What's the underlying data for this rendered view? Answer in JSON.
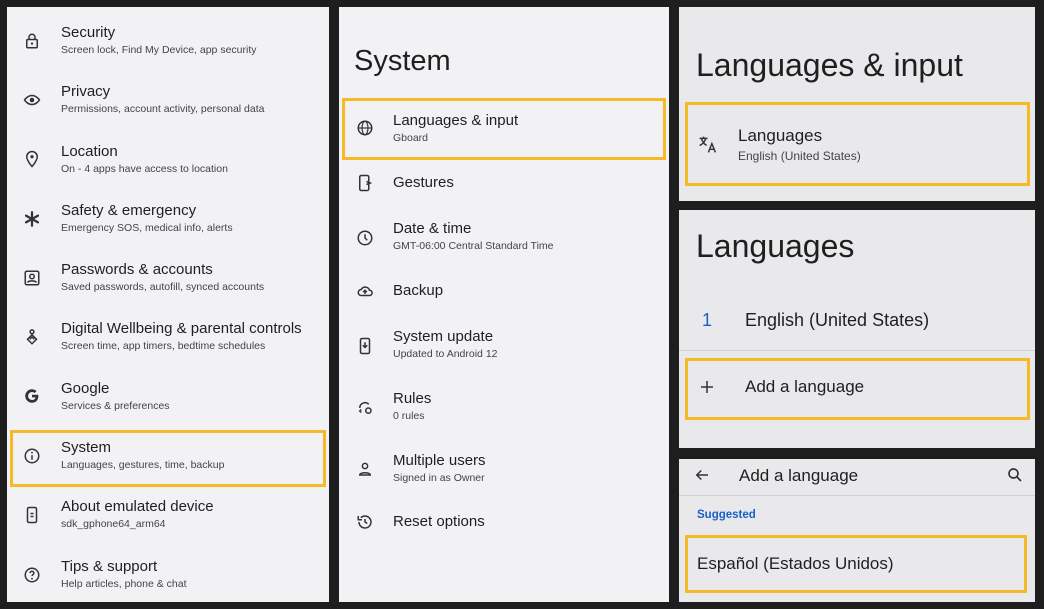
{
  "settings_list": {
    "items": [
      {
        "title": "Security",
        "subtitle": "Screen lock, Find My Device, app security",
        "icon": "lock-icon"
      },
      {
        "title": "Privacy",
        "subtitle": "Permissions, account activity, personal data",
        "icon": "eye-icon"
      },
      {
        "title": "Location",
        "subtitle": "On - 4 apps have access to location",
        "icon": "location-pin-icon"
      },
      {
        "title": "Safety & emergency",
        "subtitle": "Emergency SOS, medical info, alerts",
        "icon": "asterisk-icon"
      },
      {
        "title": "Passwords & accounts",
        "subtitle": "Saved passwords, autofill, synced accounts",
        "icon": "account-box-icon"
      },
      {
        "title": "Digital Wellbeing & parental controls",
        "subtitle": "Screen time, app timers, bedtime schedules",
        "icon": "wellbeing-icon"
      },
      {
        "title": "Google",
        "subtitle": "Services & preferences",
        "icon": "google-g-icon"
      },
      {
        "title": "System",
        "subtitle": "Languages, gestures, time, backup",
        "icon": "info-icon"
      },
      {
        "title": "About emulated device",
        "subtitle": "sdk_gphone64_arm64",
        "icon": "device-icon"
      },
      {
        "title": "Tips & support",
        "subtitle": "Help articles, phone & chat",
        "icon": "help-icon"
      }
    ]
  },
  "system_screen": {
    "title": "System",
    "items": [
      {
        "title": "Languages & input",
        "subtitle": "Gboard",
        "icon": "globe-icon"
      },
      {
        "title": "Gestures",
        "subtitle": "",
        "icon": "gestures-icon"
      },
      {
        "title": "Date & time",
        "subtitle": "GMT-06:00 Central Standard Time",
        "icon": "clock-icon"
      },
      {
        "title": "Backup",
        "subtitle": "",
        "icon": "cloud-upload-icon"
      },
      {
        "title": "System update",
        "subtitle": "Updated to Android 12",
        "icon": "system-update-icon"
      },
      {
        "title": "Rules",
        "subtitle": "0 rules",
        "icon": "rules-icon"
      },
      {
        "title": "Multiple users",
        "subtitle": "Signed in as Owner",
        "icon": "person-icon"
      },
      {
        "title": "Reset options",
        "subtitle": "",
        "icon": "history-icon"
      }
    ]
  },
  "languages_input_screen": {
    "title": "Languages & input",
    "item": {
      "title": "Languages",
      "subtitle": "English (United States)",
      "icon": "translate-icon"
    }
  },
  "languages_screen": {
    "title": "Languages",
    "languages": [
      {
        "rank": "1",
        "name": "English (United States)"
      }
    ],
    "add_label": "Add a language"
  },
  "add_language_screen": {
    "title": "Add a language",
    "section_label": "Suggested",
    "suggestion": "Español (Estados Unidos)"
  },
  "colors": {
    "highlight": "#f6b92a",
    "accent_blue": "#1a5fc7"
  }
}
